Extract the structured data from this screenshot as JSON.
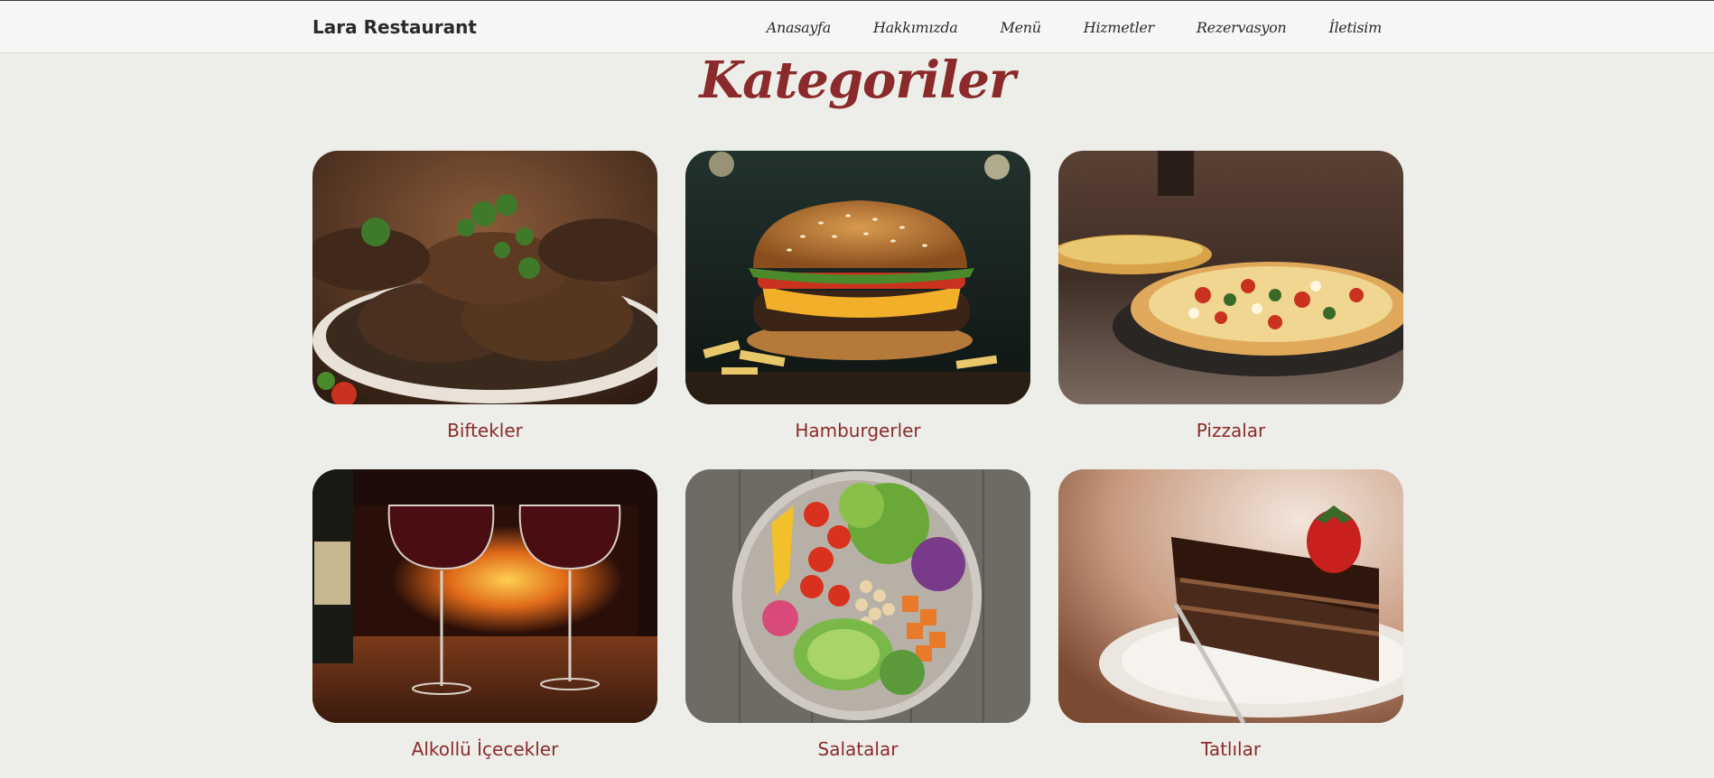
{
  "navbar": {
    "brand": "Lara Restaurant",
    "links": [
      "Anasayfa",
      "Hakkımızda",
      "Menü",
      "Hizmetler",
      "Rezervasyon",
      "İletisim"
    ]
  },
  "main": {
    "title": "Kategoriler",
    "categories": [
      {
        "label": "Biftekler",
        "image": "grilled-steaks-photo"
      },
      {
        "label": "Hamburgerler",
        "image": "burger-photo"
      },
      {
        "label": "Pizzalar",
        "image": "pizza-photo"
      },
      {
        "label": "Alkollü İçecekler",
        "image": "wine-glasses-photo"
      },
      {
        "label": "Salatalar",
        "image": "salad-bowl-photo"
      },
      {
        "label": "Tatlılar",
        "image": "chocolate-cake-photo"
      }
    ]
  },
  "colors": {
    "background": "#edeee9",
    "accent": "#8b2a2a",
    "navbar": "#f6f6f5"
  }
}
